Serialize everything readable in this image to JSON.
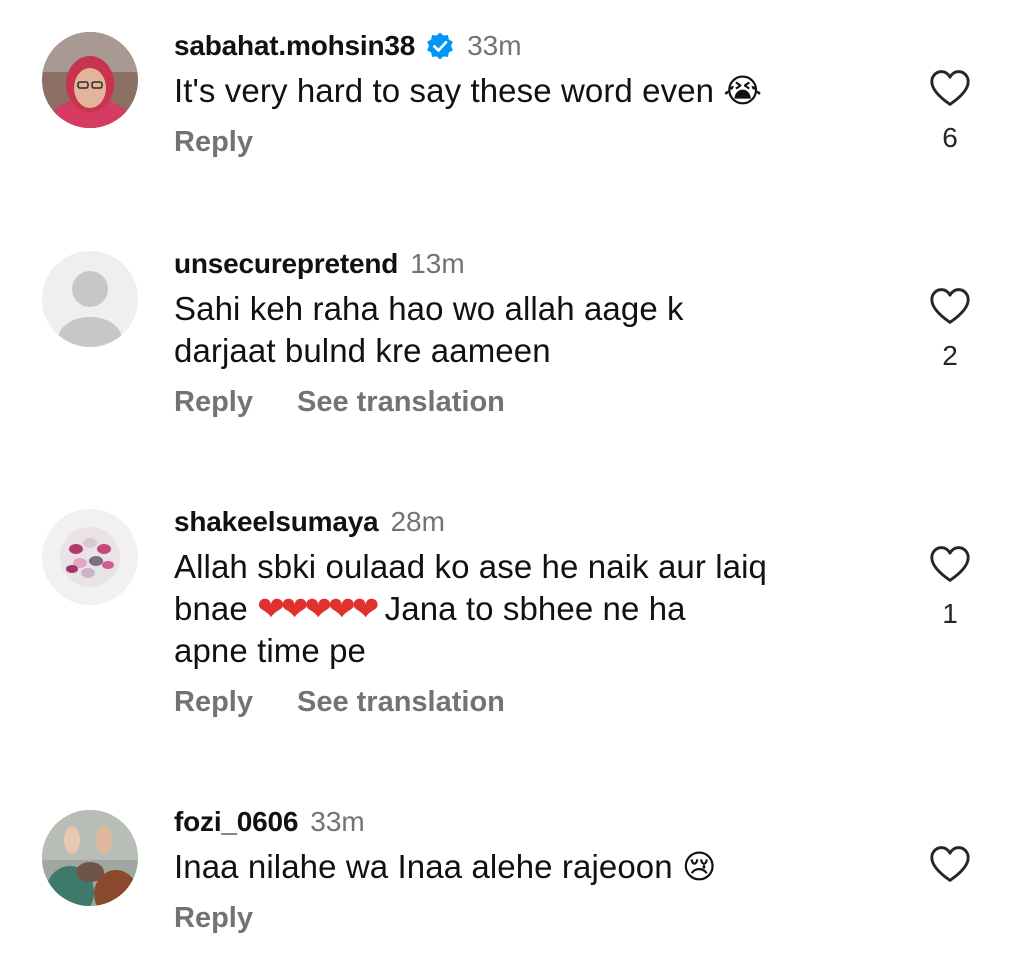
{
  "comments": [
    {
      "username": "sabahat.mohsin38",
      "verified": true,
      "time": "33m",
      "text": "It's very hard to say these word even",
      "emoji": "😭",
      "reply_label": "Reply",
      "like_count": "6"
    },
    {
      "username": "unsecurepretend",
      "time": "13m",
      "text_line1": "Sahi keh raha hao wo allah aage k",
      "text_line2": "darjaat bulnd kre aameen",
      "reply_label": "Reply",
      "translate_label": "See translation",
      "like_count": "2"
    },
    {
      "username": "shakeelsumaya",
      "time": "28m",
      "text_line1": "Allah sbki oulaad ko ase he naik aur laiq",
      "text_line2_start": "bnae ",
      "hearts": "❤❤❤❤❤",
      "text_line2_end": "Jana to sbhee ne ha",
      "text_line3": "apne time pe",
      "reply_label": "Reply",
      "translate_label": "See translation",
      "like_count": "1"
    },
    {
      "username": "fozi_0606",
      "time": "33m",
      "text": "Inaa nilahe wa Inaa alehe rajeoon",
      "emoji": "😢",
      "reply_label": "Reply"
    }
  ],
  "colors": {
    "secondary_text": "#737373",
    "verified_blue": "#0095f6",
    "heart_red": "#e0302f"
  },
  "icons": [
    "verified-badge-icon",
    "heart-outline-icon",
    "default-avatar-icon"
  ]
}
